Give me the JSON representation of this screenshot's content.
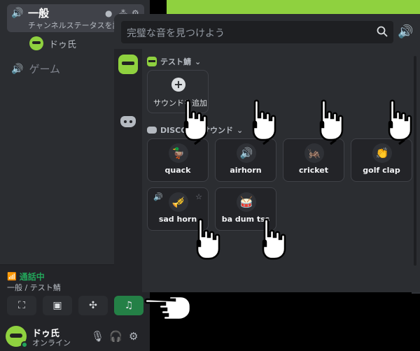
{
  "sidebar": {
    "active_channel": {
      "name": "一般",
      "status": "チャンネルステータスを設",
      "icon": "speaker-icon"
    },
    "member": {
      "name": "ドゥ氏"
    },
    "channel2": {
      "name": "ゲーム",
      "icon": "speaker-icon"
    }
  },
  "voice": {
    "status": "通話中",
    "location": "一般 / テスト鯖"
  },
  "user": {
    "name": "ドゥ氏",
    "status": "オンライン"
  },
  "soundboard": {
    "search_placeholder": "完璧な音を見つけよう",
    "server_section": "テスト鯖",
    "add_sound_label": "サウンドを追加",
    "discord_section": "DISCORD サウンド",
    "sounds": [
      {
        "label": "quack",
        "emoji": "🦆"
      },
      {
        "label": "airhorn",
        "emoji": "🔊"
      },
      {
        "label": "cricket",
        "emoji": "🦗"
      },
      {
        "label": "golf clap",
        "emoji": "👏"
      },
      {
        "label": "sad horn",
        "emoji": "🎺"
      },
      {
        "label": "ba dum tss",
        "emoji": "🥁"
      }
    ]
  },
  "colors": {
    "accent_green": "#8fd13f",
    "online": "#23a55a",
    "active_button": "#248046"
  }
}
